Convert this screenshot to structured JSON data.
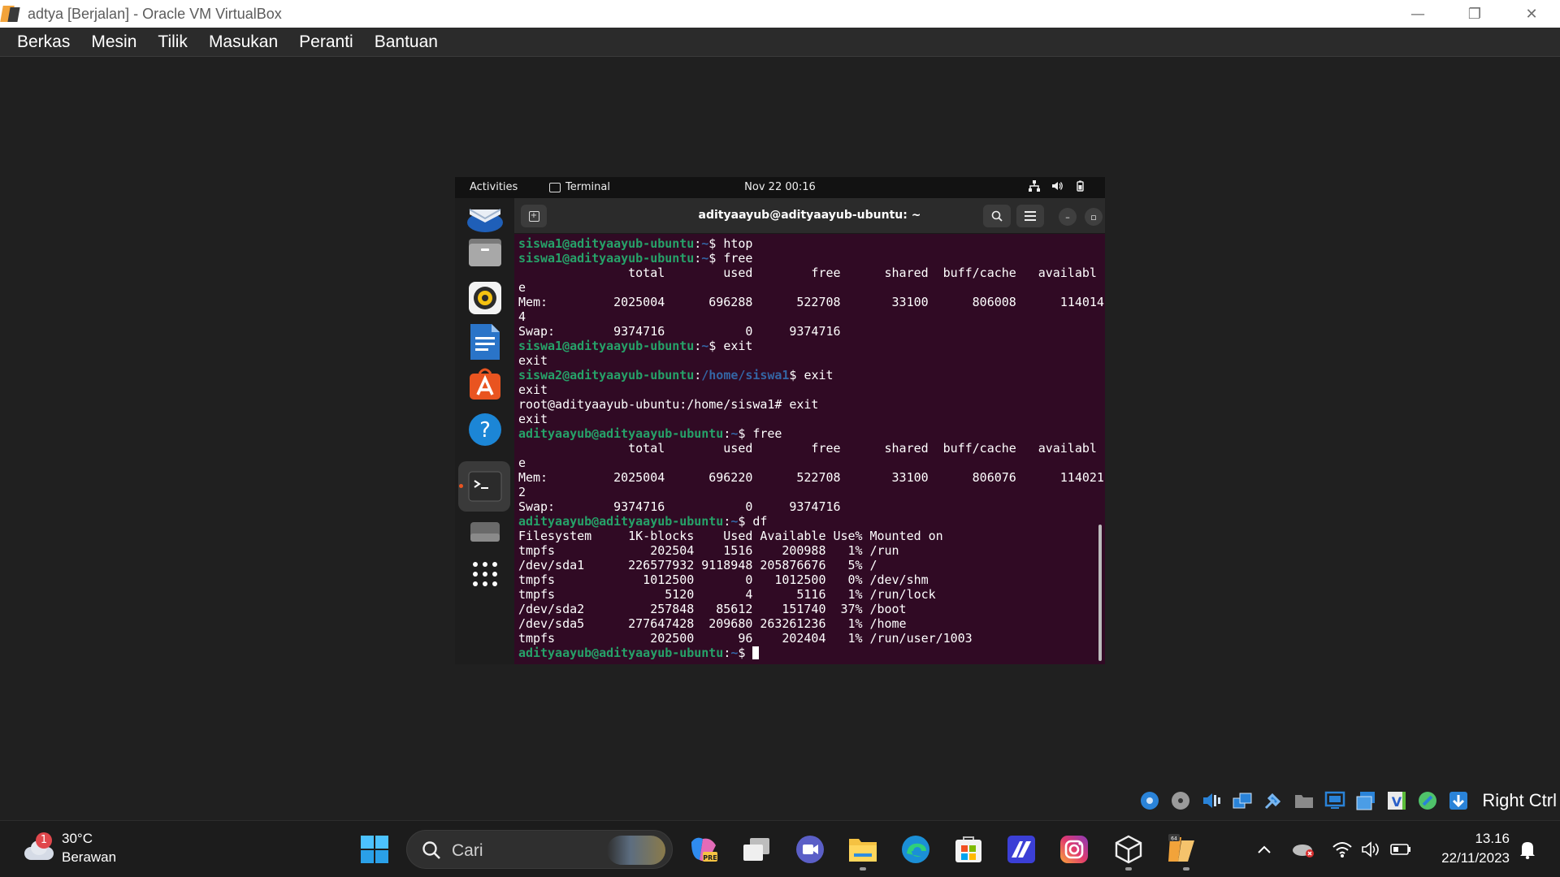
{
  "window": {
    "title": "adtya [Berjalan] - Oracle VM VirtualBox",
    "controls": {
      "minimize": "—",
      "restore": "❐",
      "close": "✕"
    }
  },
  "menubar": {
    "items": [
      "Berkas",
      "Mesin",
      "Tilik",
      "Masukan",
      "Peranti",
      "Bantuan"
    ]
  },
  "vm": {
    "topbar": {
      "activities": "Activities",
      "app": "Terminal",
      "clock": "Nov 22  00:16"
    },
    "dock_icons": [
      "thunderbird-icon",
      "files-icon",
      "rhythmbox-icon",
      "writer-icon",
      "app-center-icon",
      "help-icon",
      "terminal-icon",
      "drive-icon",
      "show-apps-icon"
    ],
    "terminal": {
      "title": "adityaayub@adityaayub-ubuntu: ~",
      "lines": [
        [
          {
            "t": "siswa1@adityaayub-ubuntu",
            "c": "pu"
          },
          {
            "t": ":",
            "c": ""
          },
          {
            "t": "~",
            "c": "pp"
          },
          {
            "t": "$ htop",
            "c": ""
          }
        ],
        [
          {
            "t": "siswa1@adityaayub-ubuntu",
            "c": "pu"
          },
          {
            "t": ":",
            "c": ""
          },
          {
            "t": "~",
            "c": "pp"
          },
          {
            "t": "$ free",
            "c": ""
          }
        ],
        [
          {
            "t": "               total        used        free      shared  buff/cache   availabl",
            "c": ""
          }
        ],
        [
          {
            "t": "e",
            "c": ""
          }
        ],
        [
          {
            "t": "Mem:         2025004      696288      522708       33100      806008      114014",
            "c": ""
          }
        ],
        [
          {
            "t": "4",
            "c": ""
          }
        ],
        [
          {
            "t": "Swap:        9374716           0     9374716",
            "c": ""
          }
        ],
        [
          {
            "t": "siswa1@adityaayub-ubuntu",
            "c": "pu"
          },
          {
            "t": ":",
            "c": ""
          },
          {
            "t": "~",
            "c": "pp"
          },
          {
            "t": "$ exit",
            "c": ""
          }
        ],
        [
          {
            "t": "exit",
            "c": ""
          }
        ],
        [
          {
            "t": "siswa2@adityaayub-ubuntu",
            "c": "pu"
          },
          {
            "t": ":",
            "c": ""
          },
          {
            "t": "/home/siswa1",
            "c": "pp"
          },
          {
            "t": "$ exit",
            "c": ""
          }
        ],
        [
          {
            "t": "exit",
            "c": ""
          }
        ],
        [
          {
            "t": "root@adityaayub-ubuntu:/home/siswa1# exit",
            "c": ""
          }
        ],
        [
          {
            "t": "exit",
            "c": ""
          }
        ],
        [
          {
            "t": "adityaayub@adityaayub-ubuntu",
            "c": "pu"
          },
          {
            "t": ":",
            "c": ""
          },
          {
            "t": "~",
            "c": "pp"
          },
          {
            "t": "$ free",
            "c": ""
          }
        ],
        [
          {
            "t": "               total        used        free      shared  buff/cache   availabl",
            "c": ""
          }
        ],
        [
          {
            "t": "e",
            "c": ""
          }
        ],
        [
          {
            "t": "Mem:         2025004      696220      522708       33100      806076      114021",
            "c": ""
          }
        ],
        [
          {
            "t": "2",
            "c": ""
          }
        ],
        [
          {
            "t": "Swap:        9374716           0     9374716",
            "c": ""
          }
        ],
        [
          {
            "t": "adityaayub@adityaayub-ubuntu",
            "c": "pu"
          },
          {
            "t": ":",
            "c": ""
          },
          {
            "t": "~",
            "c": "pp"
          },
          {
            "t": "$ df",
            "c": ""
          }
        ],
        [
          {
            "t": "Filesystem     1K-blocks    Used Available Use% Mounted on",
            "c": ""
          }
        ],
        [
          {
            "t": "tmpfs             202504    1516    200988   1% /run",
            "c": ""
          }
        ],
        [
          {
            "t": "/dev/sda1      226577932 9118948 205876676   5% /",
            "c": ""
          }
        ],
        [
          {
            "t": "tmpfs            1012500       0   1012500   0% /dev/shm",
            "c": ""
          }
        ],
        [
          {
            "t": "tmpfs               5120       4      5116   1% /run/lock",
            "c": ""
          }
        ],
        [
          {
            "t": "/dev/sda2         257848   85612    151740  37% /boot",
            "c": ""
          }
        ],
        [
          {
            "t": "/dev/sda5      277647428  209680 263261236   1% /home",
            "c": ""
          }
        ],
        [
          {
            "t": "tmpfs             202500      96    202404   1% /run/user/1003",
            "c": ""
          }
        ],
        [
          {
            "t": "adityaayub@adityaayub-ubuntu",
            "c": "pu"
          },
          {
            "t": ":",
            "c": ""
          },
          {
            "t": "~",
            "c": "pp"
          },
          {
            "t": "$ ",
            "c": ""
          },
          {
            "t": "",
            "c": "cursor"
          }
        ]
      ]
    }
  },
  "vbox_status": {
    "icons": [
      "hard-disk-icon",
      "optical-drive-icon",
      "audio-icon",
      "network-icon",
      "usb-icon",
      "shared-folders-icon",
      "display-icon",
      "recording-icon",
      "vm-state-icon",
      "mouse-integration-icon",
      "keyboard-icon"
    ],
    "host_key": "Right Ctrl"
  },
  "taskbar": {
    "weather": {
      "temp": "30°C",
      "condition": "Berawan",
      "badge": "1"
    },
    "search_label": "Cari",
    "time": "13.16",
    "date": "22/11/2023"
  }
}
